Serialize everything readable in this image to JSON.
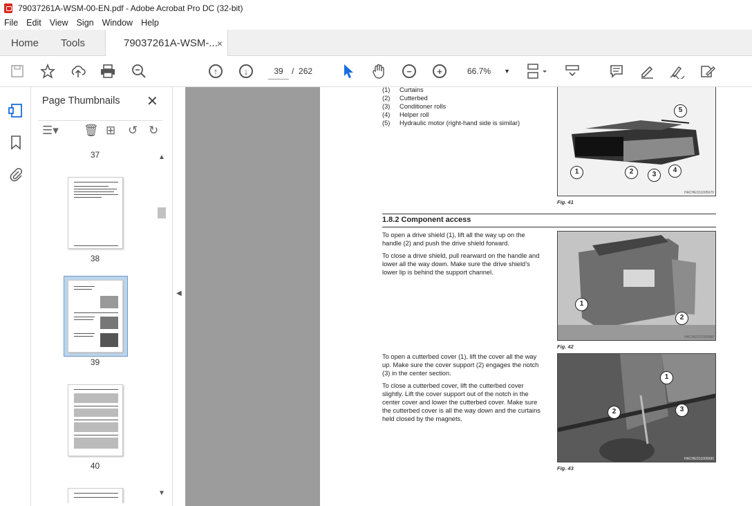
{
  "window": {
    "title": "79037261A-WSM-00-EN.pdf - Adobe Acrobat Pro DC (32-bit)"
  },
  "menu": [
    "File",
    "Edit",
    "View",
    "Sign",
    "Window",
    "Help"
  ],
  "tabs": {
    "home": "Home",
    "tools": "Tools",
    "doc": "79037261A-WSM-...",
    "close": "×"
  },
  "toolbar": {
    "page_current": "39",
    "page_sep": "/",
    "page_total": "262",
    "zoom": "66.7%"
  },
  "panel": {
    "title": "Page Thumbnails",
    "pages": [
      "37",
      "38",
      "39",
      "40"
    ],
    "selected_page": "39"
  },
  "doc": {
    "legend": [
      {
        "num": "(1)",
        "text": "Curtains"
      },
      {
        "num": "(2)",
        "text": "Cutterbed"
      },
      {
        "num": "(3)",
        "text": "Conditioner rolls"
      },
      {
        "num": "(4)",
        "text": "Helper roll"
      },
      {
        "num": "(5)",
        "text": "Hydraulic motor (right-hand side is similar)"
      }
    ],
    "section_title": "1.8.2  Component access",
    "para1": "To open a drive shield (1), lift all the way up on the handle (2) and push the drive shield forward.",
    "para2": "To close a drive shield, pull rearward on the handle and lower all the way down. Make sure the drive shield’s lower lip is behind the support channel.",
    "para3": "To open a cutterbed cover (1), lift the cover all the way up. Make sure the cover support (2) engages the notch (3) in the center section.",
    "para4": "To close a cutterbed cover, lift the cutterbed cover slightly. Lift the cover support out of the notch in the center cover and lower the cutterbed cover. Make sure the cutterbed cover is all the way down and the curtains held closed by the magnets.",
    "fig41": {
      "caption": "Fig. 41",
      "ref": "HACHED11005670",
      "callouts": [
        "1",
        "2",
        "3",
        "4",
        "5"
      ]
    },
    "fig42": {
      "caption": "Fig. 42",
      "ref": "HACHED11005680",
      "callouts": [
        "1",
        "2"
      ]
    },
    "fig43": {
      "caption": "Fig. 43",
      "ref": "HACHED11005690",
      "callouts": [
        "1",
        "2",
        "3"
      ]
    }
  }
}
